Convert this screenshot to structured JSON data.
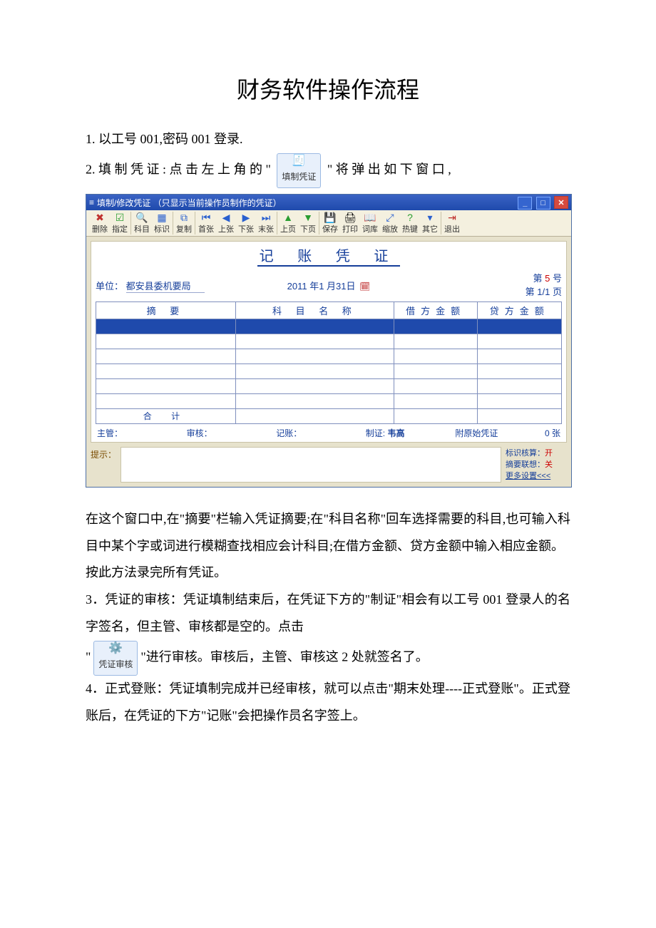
{
  "title": "财务软件操作流程",
  "p1": "1. 以工号 001,密码 001 登录.",
  "p2_a": "2. 填 制 凭 证 : 点 击 左 上 角 的 \"",
  "icon_fill": "填制凭证",
  "p2_b": "\" 将 弹 出 如 下 窗 口 ,",
  "voucher": {
    "title": "填制/修改凭证 （只显示当前操作员制作的凭证）",
    "toolbar": [
      "删除",
      "指定",
      "科目",
      "标识",
      "复制",
      "首张",
      "上张",
      "下张",
      "末张",
      "上页",
      "下页",
      "保存",
      "打印",
      "词库",
      "缩放",
      "热键",
      "其它",
      "退出"
    ],
    "heading": "记 账 凭 证",
    "unit_lbl": "单位：",
    "unit_val": "都安县委机要局",
    "date": "2011 年1 月31日",
    "num_lbl": "第",
    "num_val": "5",
    "num_unit": "号",
    "page_lbl": "第",
    "page_val": "1/1",
    "page_unit": "页",
    "cols": {
      "summary": "摘   要",
      "subject": "科 目 名 称",
      "debit": "借方金额",
      "credit": "贷方金额"
    },
    "total": "合    计",
    "sigs": {
      "mgr": "主管：",
      "audit": "审核：",
      "book": "记账：",
      "make_lbl": "制证:",
      "make_val": "韦高",
      "orig": "附原始凭证",
      "orig_n": "0 张"
    },
    "tips_lbl": "提示：",
    "flag1": "标识核算：",
    "flag1v": "开",
    "flag2": "摘要联想：",
    "flag2v": "关",
    "more": "更多设置<<<"
  },
  "p3": "在这个窗口中,在\"摘要\"栏输入凭证摘要;在\"科目名称\"回车选择需要的科目,也可输入科目中某个字或词进行模糊查找相应会计科目;在借方金额、贷方金额中输入相应金额。",
  "p4": "按此方法录完所有凭证。",
  "p5": "3．凭证的审核：凭证填制结束后，在凭证下方的\"制证\"相会有以工号 001 登录人的名字签名，但主管、审核都是空的。点击",
  "icon_audit": "凭证审核",
  "p6": "\"进行审核。审核后，主管、审核这 2 处就签名了。",
  "p7": "4．正式登账：凭证填制完成并已经审核，就可以点击\"期末处理----正式登账\"。正式登账后，在凭证的下方\"记账\"会把操作员名字签上。"
}
